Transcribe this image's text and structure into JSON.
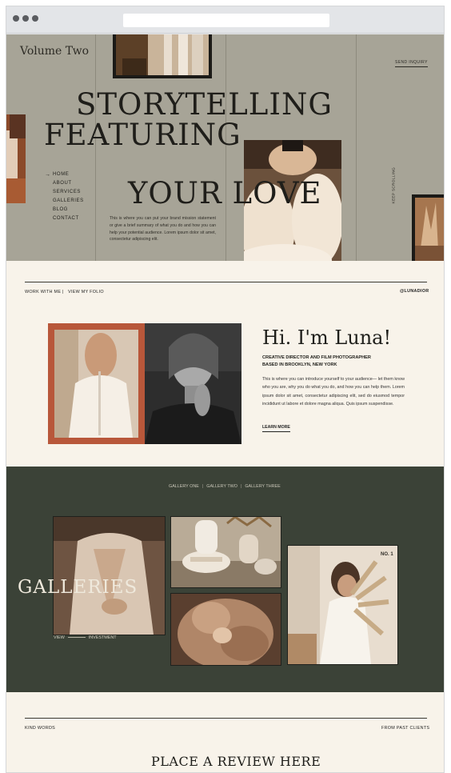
{
  "hero": {
    "volume": "Volume Two",
    "send_inquiry": "SEND INQUIRY",
    "title_line1": "STORYTELLING",
    "title_line2": "FEATURING",
    "title_line3": "YOUR LOVE",
    "nav": [
      "HOME",
      "ABOUT",
      "SERVICES",
      "GALLERIES",
      "BLOG",
      "CONTACT"
    ],
    "description": "This is where you can put your brand mission statement or give a brief summary of what you do and how you can help your potential audience. Lorem ipsum dolor sit amet, consectetur adipiscing elit.",
    "keep_scrolling": "KEEP SCROLLING"
  },
  "intro": {
    "work_with_me": "WORK WITH ME",
    "divider": "|",
    "view_folio": "VIEW MY FOLIO",
    "handle": "@LUNADIOR",
    "greeting": "Hi. I'm Luna!",
    "role_line1": "CREATIVE DIRECTOR AND FILM PHOTOGRAPHER",
    "role_line2": "BASED IN BROOKLYN, NEW YORK",
    "bio": "This is where you can introduce yourself to your audience— let them know who you are, why you do what you do, and how you can help them.  Lorem ipsum dolor sit amet, consectetur adipiscing elit, sed do eiusmod tempor incididunt ut labore et dolore magna aliqua. Quis ipsum suspendisse.",
    "learn_more": "LEARN MORE"
  },
  "gallery": {
    "tabs": [
      "GALLERY ONE",
      "GALLERY TWO",
      "GALLERY THREE"
    ],
    "title": "GALLERIES",
    "view": "VIEW",
    "investment": "INVESTMENT",
    "badge": "NO. 1"
  },
  "reviews": {
    "kind_words": "KIND WORDS",
    "from_clients": "FROM PAST CLIENTS",
    "title": "PLACE A REVIEW HERE"
  },
  "colors": {
    "hero_bg": "#a7a497",
    "cream": "#f8f3ea",
    "gallery_bg": "#3b4237",
    "accent_rust": "#b8573a"
  }
}
